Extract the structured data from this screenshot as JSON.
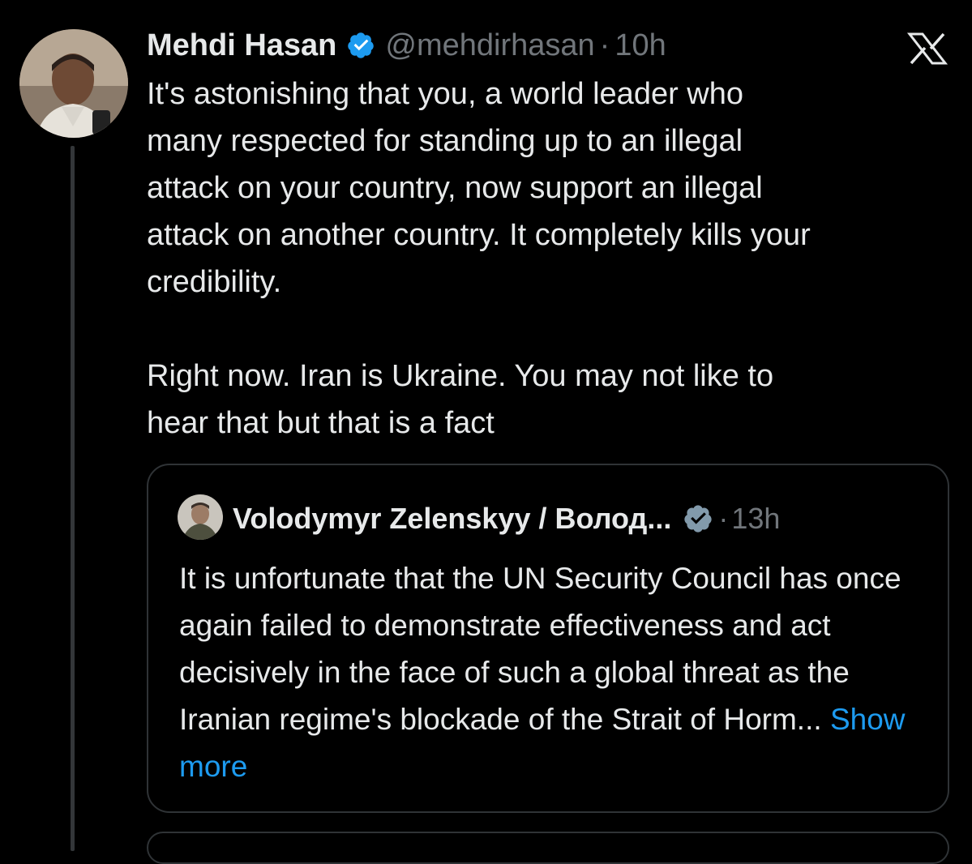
{
  "post": {
    "author_name": "Mehdi Hasan",
    "handle": "@mehdirhasan",
    "separator": "·",
    "time": "10h",
    "body": "It's astonishing that you, a world leader who\nmany respected for standing up to an illegal\nattack on your country, now support an illegal\nattack on another country. It completely kills your\ncredibility.\n\nRight now. Iran is Ukraine. You may not like to\nhear that but that is a fact",
    "verified_icon": "verified-badge-icon",
    "avatar_icon": "avatar-photo"
  },
  "quote": {
    "author_name": "Volodymyr Zelenskyy / Волод...",
    "separator": "·",
    "time": "13h",
    "body": "It is unfortunate that the UN Security Council has once again failed to demonstrate effectiveness and act decisively in the face of such a global threat as the Iranian regime's blockade of the Strait of Horm...",
    "show_more": "Show more",
    "verified_icon": "verified-badge-gray-icon",
    "avatar_icon": "avatar-photo"
  },
  "app": {
    "logo_icon": "x-logo-icon"
  },
  "colors": {
    "background": "#000000",
    "text": "#e7e9ea",
    "muted": "#71767b",
    "accent": "#1d9bf0",
    "border": "#2f3336",
    "verified_blue": "#1d9bf0",
    "verified_gray": "#829aab"
  }
}
